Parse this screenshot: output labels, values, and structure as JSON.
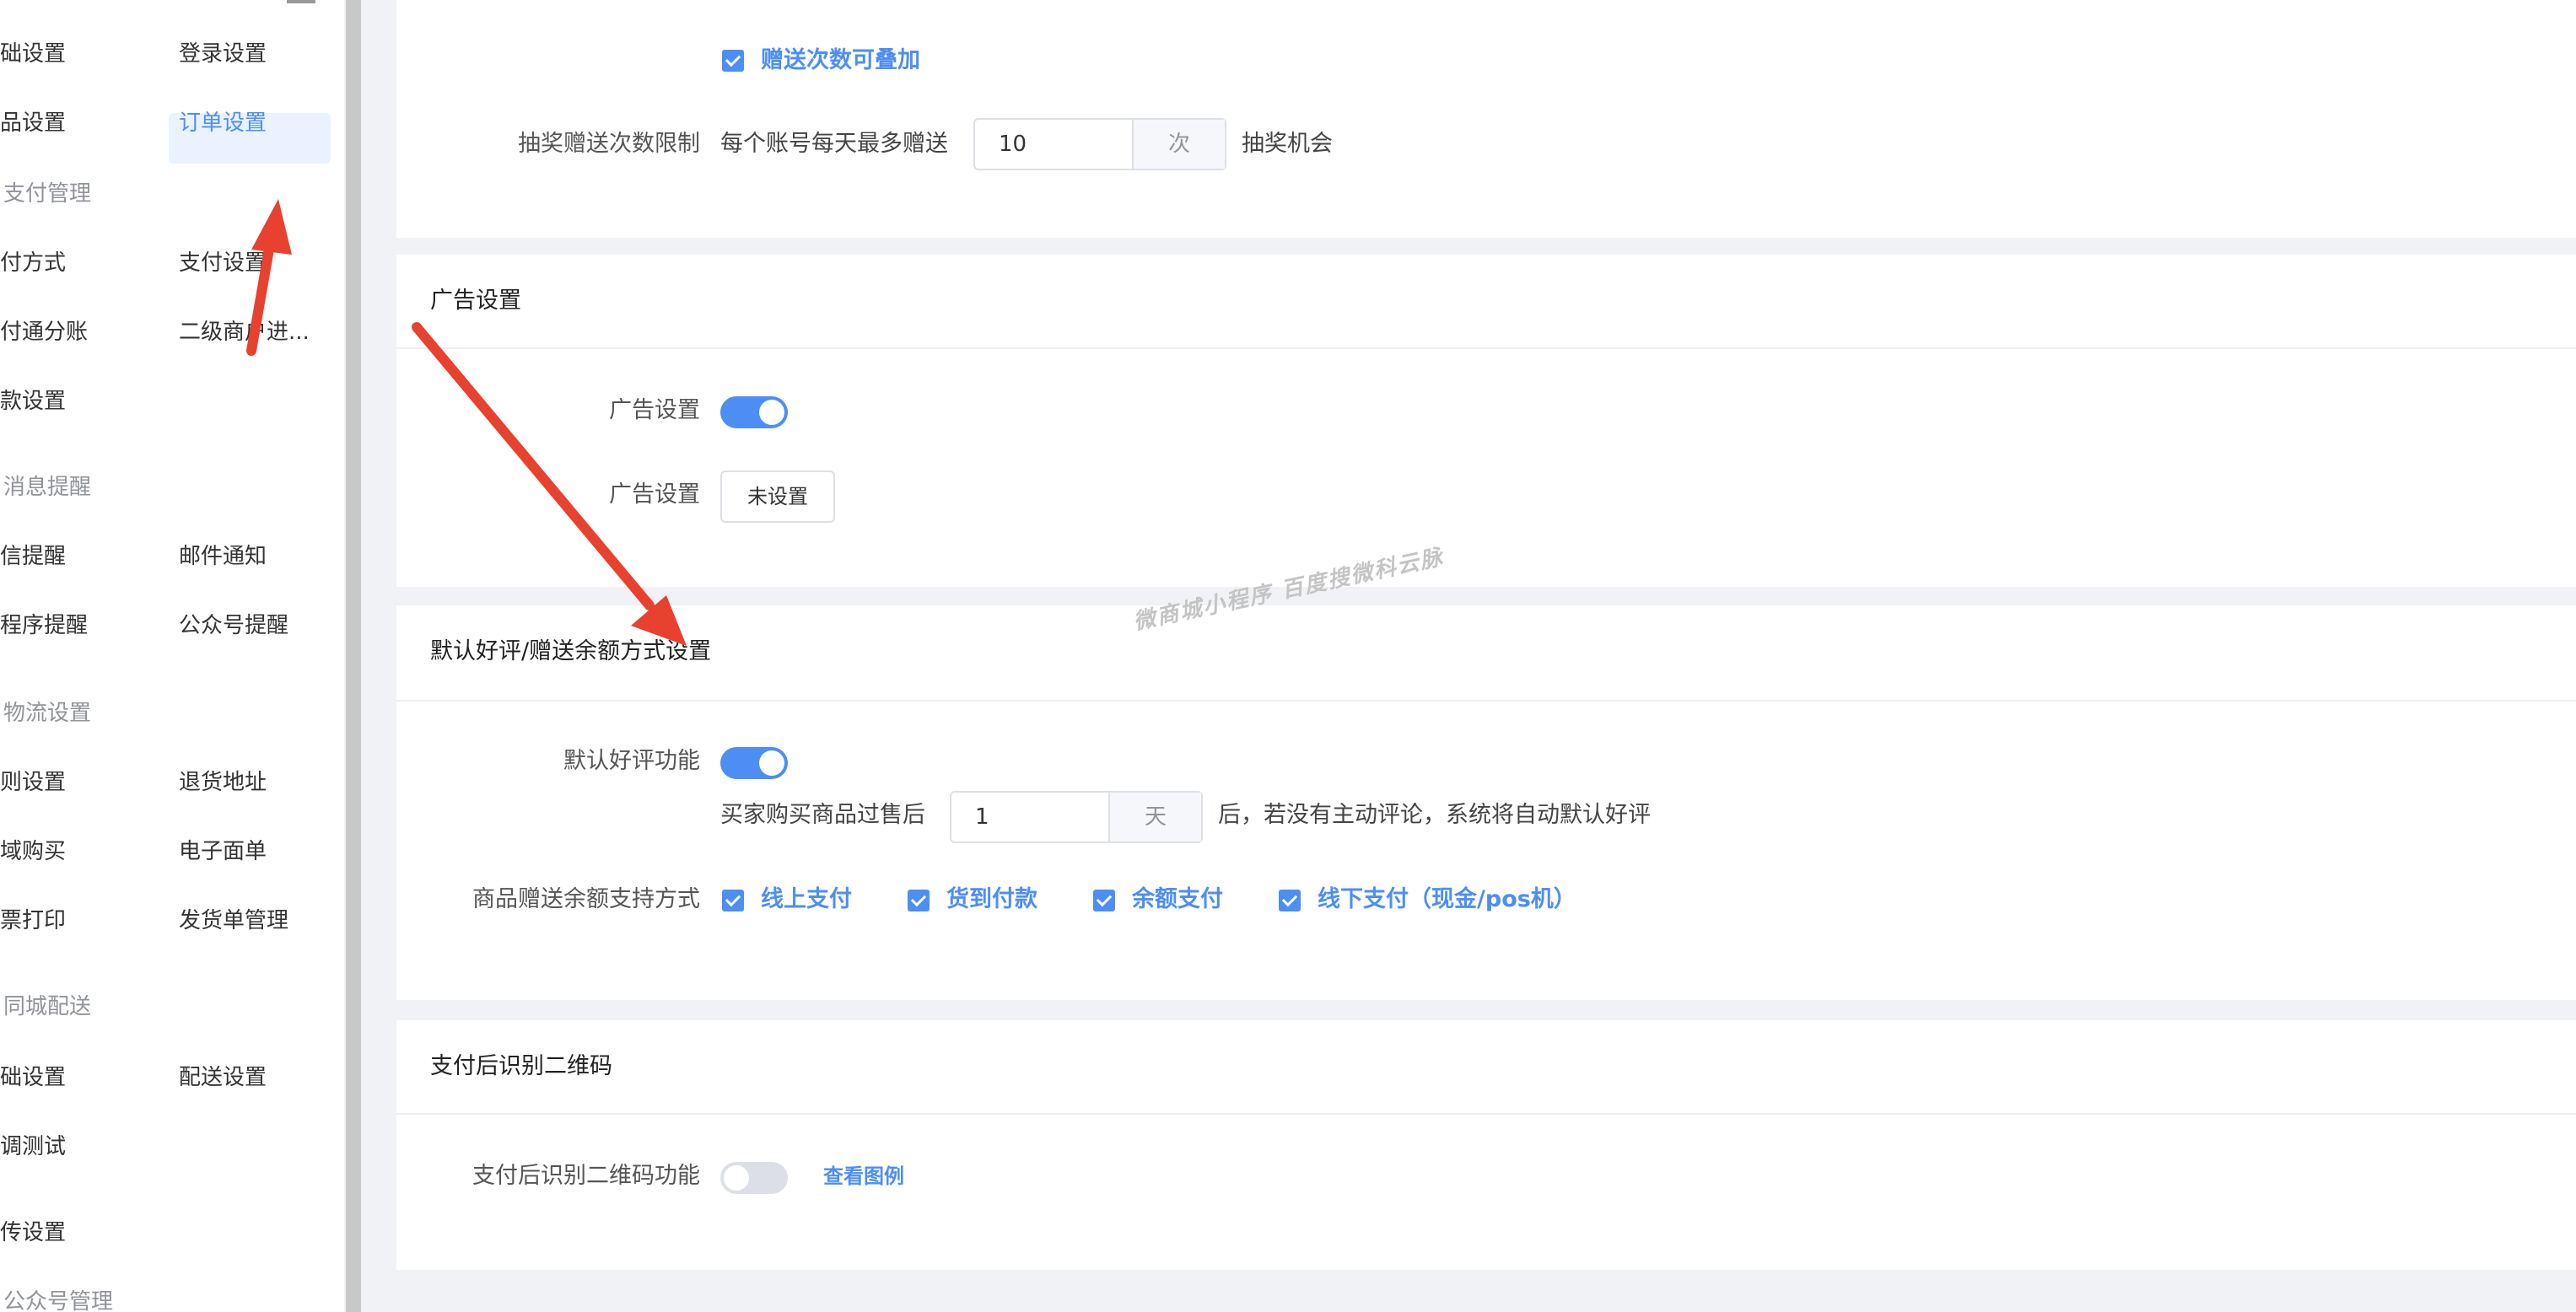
{
  "sidebar": {
    "rows": [
      {
        "left": {
          "type": "item",
          "label": "基础设置"
        },
        "right": {
          "type": "item",
          "label": "登录设置"
        }
      },
      {
        "left": {
          "type": "item",
          "label": "商品设置"
        },
        "right": {
          "type": "item",
          "label": "订单设置",
          "active": true
        }
      },
      {
        "left": {
          "type": "group",
          "label": "支付管理"
        },
        "right": null
      },
      {
        "left": {
          "type": "item",
          "label": "支付方式"
        },
        "right": {
          "type": "item",
          "label": "支付设置"
        }
      },
      {
        "left": {
          "type": "item",
          "label": "收付通分账"
        },
        "right": {
          "type": "item",
          "label": "二级商户进..."
        }
      },
      {
        "left": {
          "type": "item",
          "label": "打款设置"
        },
        "right": null
      },
      {
        "left": {
          "type": "group",
          "label": "消息提醒"
        },
        "right": null
      },
      {
        "left": {
          "type": "item",
          "label": "短信提醒"
        },
        "right": {
          "type": "item",
          "label": "邮件通知"
        }
      },
      {
        "left": {
          "type": "item",
          "label": "小程序提醒"
        },
        "right": {
          "type": "item",
          "label": "公众号提醒"
        }
      },
      {
        "left": {
          "type": "group",
          "label": "物流设置"
        },
        "right": null
      },
      {
        "left": {
          "type": "item",
          "label": "规则设置"
        },
        "right": {
          "type": "item",
          "label": "退货地址"
        }
      },
      {
        "left": {
          "type": "item",
          "label": "区域购买"
        },
        "right": {
          "type": "item",
          "label": "电子面单"
        }
      },
      {
        "left": {
          "type": "item",
          "label": "小票打印"
        },
        "right": {
          "type": "item",
          "label": "发货单管理"
        }
      },
      {
        "left": {
          "type": "group",
          "label": "同城配送"
        },
        "right": null
      },
      {
        "left": {
          "type": "item",
          "label": "基础设置"
        },
        "right": {
          "type": "item",
          "label": "配送设置"
        }
      },
      {
        "left": {
          "type": "item",
          "label": "联调测试"
        },
        "right": null
      },
      {
        "left": {
          "type": "item",
          "label": "上传设置"
        },
        "right": null
      },
      {
        "left": {
          "type": "group",
          "label": "公众号管理"
        },
        "right": null
      }
    ]
  },
  "lottery": {
    "stack_checkbox_label": "赠送次数可叠加",
    "limit_label": "抽奖赠送次数限制",
    "limit_prefix": "每个账号每天最多赠送",
    "limit_value": "10",
    "limit_unit": "次",
    "limit_suffix": "抽奖机会"
  },
  "ad_settings": {
    "title": "广告设置",
    "toggle_label": "广告设置",
    "toggle_on": true,
    "button_row_label": "广告设置",
    "button_label": "未设置"
  },
  "review": {
    "title": "默认好评/赠送余额方式设置",
    "toggle_label": "默认好评功能",
    "toggle_on": true,
    "days_prefix": "买家购买商品过售后",
    "days_value": "1",
    "days_unit": "天",
    "days_suffix": "后，若没有主动评论，系统将自动默认好评",
    "methods_label": "商品赠送余额支持方式",
    "methods": [
      {
        "label": "线上支付",
        "checked": true
      },
      {
        "label": "货到付款",
        "checked": true
      },
      {
        "label": "余额支付",
        "checked": true
      },
      {
        "label": "线下支付（现金/pos机）",
        "checked": true
      }
    ]
  },
  "qrcode": {
    "title": "支付后识别二维码",
    "toggle_label": "支付后识别二维码功能",
    "toggle_on": false,
    "example_link": "查看图例"
  },
  "watermark": "微商城小程序 百度搜微科云脉",
  "colors": {
    "accent": "#4d8ef5",
    "arrow": "#e8412f",
    "active_bg": "#eaf2ff",
    "page_bg": "#f0f2f5"
  }
}
